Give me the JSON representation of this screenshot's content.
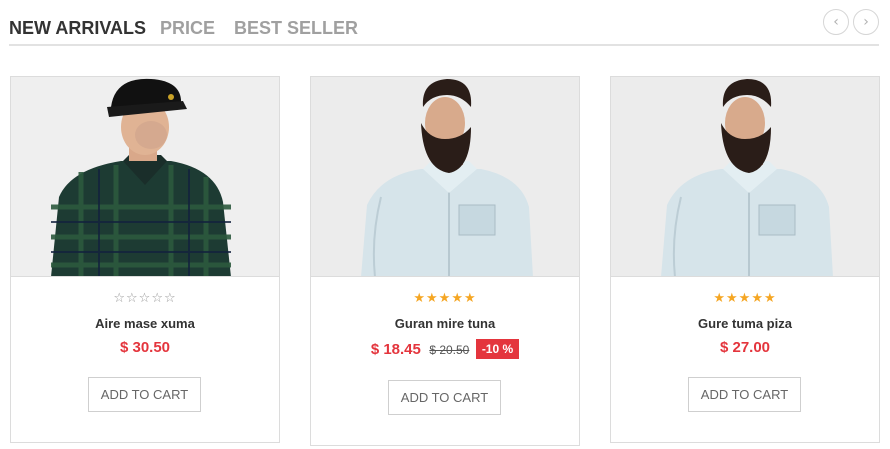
{
  "tabs": [
    {
      "label": "NEW ARRIVALS",
      "active": true
    },
    {
      "label": "PRICE",
      "active": false
    },
    {
      "label": "BEST SELLER",
      "active": false
    }
  ],
  "carousel": {
    "prev_icon": "chevron-left-icon",
    "next_icon": "chevron-right-icon",
    "prev_glyph": "‹",
    "next_glyph": "›"
  },
  "products": [
    {
      "name": "Aire mase xuma",
      "price": "$ 30.50",
      "old_price": "",
      "discount": "",
      "rating": 0,
      "max_rating": 5,
      "button": "ADD TO CART",
      "image": "man in black cap and green plaid shirt"
    },
    {
      "name": "Guran mire tuna",
      "price": "$ 18.45",
      "old_price": "$ 20.50",
      "discount": "-10 %",
      "rating": 5,
      "max_rating": 5,
      "button": "ADD TO CART",
      "image": "bearded man in light denim shirt"
    },
    {
      "name": "Gure tuma piza",
      "price": "$ 27.00",
      "old_price": "",
      "discount": "",
      "rating": 5,
      "max_rating": 5,
      "button": "ADD TO CART",
      "image": "bearded man in light denim shirt"
    }
  ],
  "colors": {
    "accent": "#e4353d",
    "star": "#f5a623",
    "tab_active": "#333333",
    "tab_inactive": "#a0a0a0",
    "border": "#dcdcdc"
  }
}
